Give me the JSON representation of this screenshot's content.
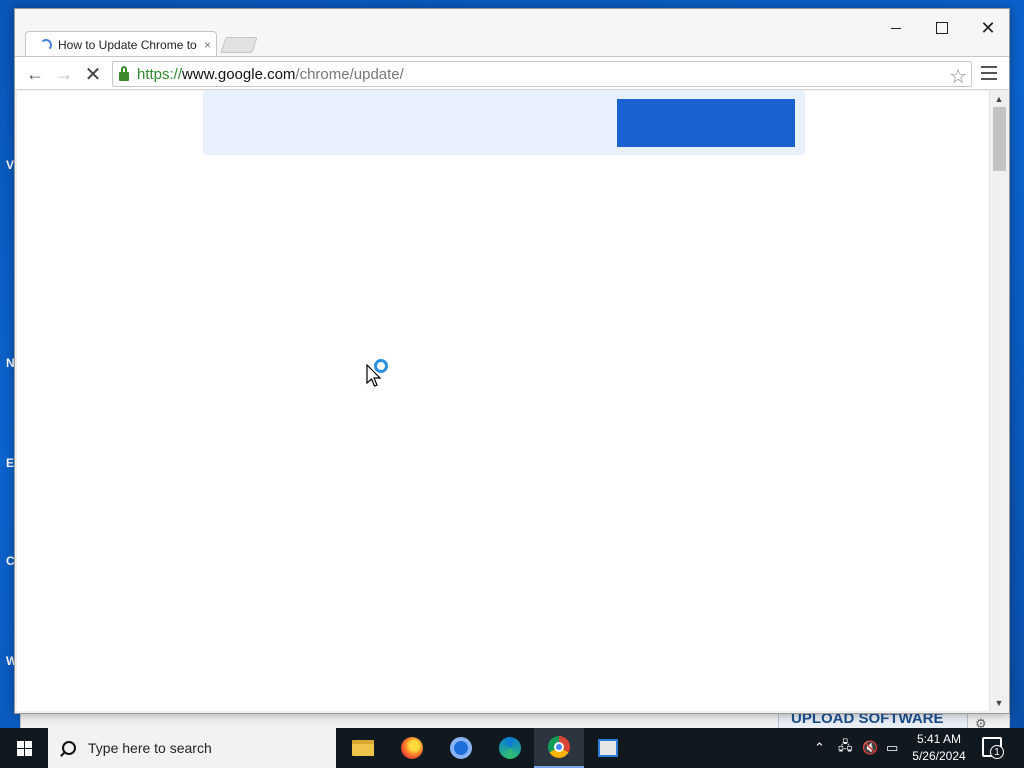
{
  "desktop": {
    "fragments": [
      "V",
      "N",
      "E",
      "C",
      "W"
    ]
  },
  "browser": {
    "tab": {
      "title": "How to Update Chrome to",
      "close_glyph": "×"
    },
    "address": {
      "scheme": "https://",
      "host": "www.google.com",
      "path": "/chrome/update/"
    },
    "nav": {
      "back": "←",
      "forward": "→",
      "stop": "✕"
    },
    "star": "☆",
    "window_close": "✕"
  },
  "background_app": {
    "upload_label": "UPLOAD SOFTWARE"
  },
  "taskbar": {
    "search_placeholder": "Type here to search",
    "apps": [
      "file-explorer",
      "firefox",
      "chromium",
      "edge",
      "chrome",
      "tool"
    ],
    "tray": {
      "time": "5:41 AM",
      "date": "5/26/2024",
      "notification_count": "1"
    }
  },
  "colors": {
    "banner_bg": "#e8f0fe",
    "banner_button": "#1a62d2",
    "desktop": "#0b63cf",
    "taskbar": "#101820"
  }
}
